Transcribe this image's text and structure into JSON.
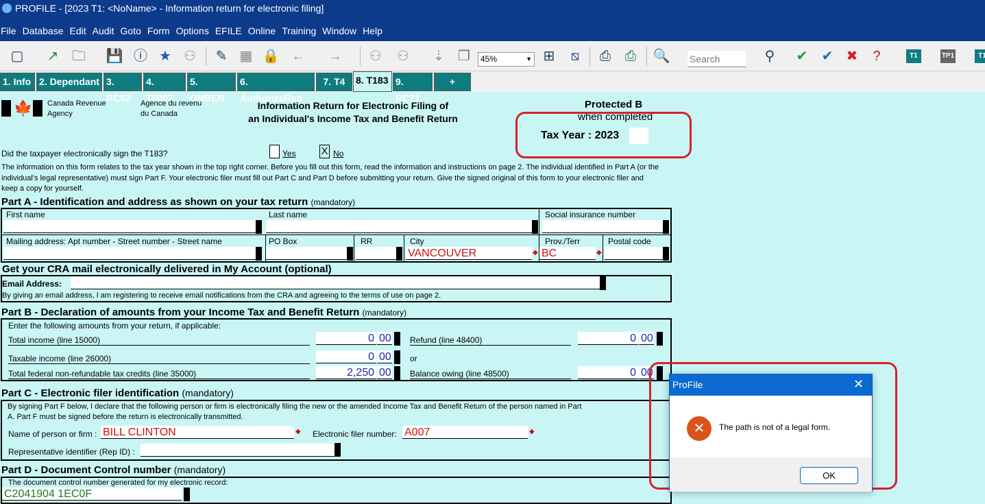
{
  "window": {
    "title": "PROFILE - [2023 T1: <NoName> - Information return for electronic filing]"
  },
  "menu": [
    "File",
    "Database",
    "Edit",
    "Audit",
    "Goto",
    "Form",
    "Options",
    "EFILE",
    "Online",
    "Training",
    "Window",
    "Help"
  ],
  "toolbar": {
    "zoom": "45%",
    "search_placeholder": "Search",
    "badges": [
      "T1",
      "TP1",
      "T1"
    ]
  },
  "tabs": [
    "1. Info",
    "2. Dependant",
    "3. RC62",
    "4. T5007",
    "5. ONBEN",
    "6. AuthorizeRep",
    "7. T4",
    "8. T183",
    "9. RC71",
    "+"
  ],
  "form": {
    "agency_en": [
      "Canada Revenue",
      "Agency"
    ],
    "agency_fr": [
      "Agence du revenu",
      "du Canada"
    ],
    "title": [
      "Information Return for Electronic Filing of",
      "an Individual's Income Tax and Benefit Return"
    ],
    "protected": "Protected B",
    "when_completed": "when completed",
    "tax_year": "Tax Year : 2023",
    "sign_question": "Did the taxpayer electronically sign the T183?",
    "yes": "Yes",
    "no": "No",
    "no_mark": "X",
    "intro": "The information on this form relates to the tax year shown in the top right corner. Before you fill out this form, read the information and instructions on page 2. The individual identified in Part A (or the individual's legal representative) must sign Part F. Your electronic filer must fill out Part C and Part D before submitting your return. Give the signed original of this form to your electronic filer and keep a copy for yourself.",
    "partA": {
      "title": "Part A - Identification and address as shown on your tax return",
      "note": "(mandatory)",
      "first_name": "First name",
      "last_name": "Last name",
      "sin": "Social insurance number",
      "mailing": "Mailing address: Apt number - Street number - Street name",
      "po_box": "PO Box",
      "rr": "RR",
      "city": "City",
      "city_value": "VANCOUVER",
      "prov": "Prov./Terr",
      "prov_value": "BC",
      "postal": "Postal code"
    },
    "cra_mail": {
      "title": "Get your CRA mail electronically delivered in My Account (optional)",
      "email_label": "Email Address:",
      "consent": "By giving an email address, I am registering to receive email notifications from the CRA and agreeing to the terms of use on page 2."
    },
    "partB": {
      "title": "Part B - Declaration of amounts from your Income Tax and Benefit Return",
      "note": "(mandatory)",
      "intro": "Enter the following amounts from your return, if applicable:",
      "total_income": "Total income (line 15000)",
      "total_income_v": "0",
      "taxable": "Taxable income (line 26000)",
      "taxable_v": "0",
      "credits": "Total federal non-refundable tax credits (line 35000)",
      "credits_v": "2,250",
      "refund": "Refund (line 48400)",
      "refund_v": "0",
      "or": "or",
      "balance": "Balance owing (line 48500)",
      "balance_v": "0",
      "cents": "00"
    },
    "partC": {
      "title": "Part C - Electronic filer identification",
      "note": "(mandatory)",
      "text1": "By signing Part F below, I declare that the following person or firm is electronically filing the new or the amended Income Tax and Benefit Return of the person named in Part",
      "text2": "A. Part F must be signed before the return is electronically transmitted.",
      "name_label": "Name of person or firm :",
      "name_value": "BILL CLINTON",
      "efiler_label": "Electronic filer number:",
      "efiler_value": "A007",
      "rep_label": "Representative identifier (Rep ID) :"
    },
    "partD": {
      "title": "Part D - Document Control number",
      "note": "(mandatory)",
      "text": "The document control number generated for my electronic record:",
      "value": "C2041904 1EC0F"
    }
  },
  "dialog": {
    "title": "ProFile",
    "message": "The path is not of a legal form.",
    "ok": "OK"
  }
}
